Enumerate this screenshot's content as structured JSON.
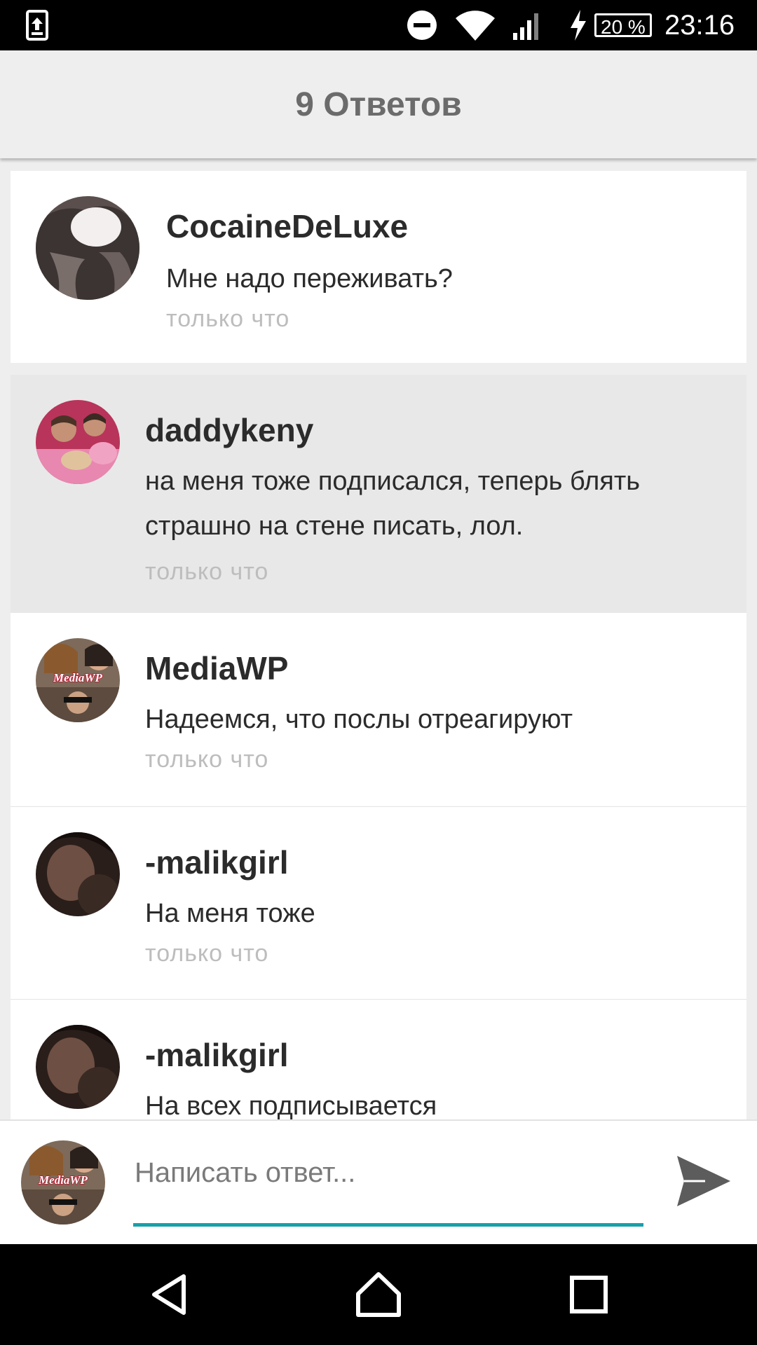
{
  "status_bar": {
    "time": "23:16",
    "battery": "20 %",
    "icons": [
      "upload-notification-icon",
      "do-not-disturb-icon",
      "wifi-icon",
      "signal-icon",
      "charging-icon"
    ]
  },
  "header": {
    "title": "9 Ответов"
  },
  "replies": [
    {
      "username": "CocaineDeLuxe",
      "message": "Мне надо переживать?",
      "time": "только что",
      "highlighted": false
    },
    {
      "username": "daddykeny",
      "message": "на меня тоже подписался, теперь блять страшно на стене писать, лол.",
      "time": "только что",
      "highlighted": true
    },
    {
      "username": "MediaWP",
      "message": "Надеемся, что послы отреагируют",
      "time": "только что",
      "highlighted": false,
      "avatar_text": "MediaWP"
    },
    {
      "username": "-malikgirl",
      "message": "На меня тоже",
      "time": "только что",
      "highlighted": false
    },
    {
      "username": "-malikgirl",
      "message": "На всех подписывается",
      "time": "",
      "highlighted": false
    }
  ],
  "reply_bar": {
    "placeholder": "Написать ответ...",
    "avatar_text": "MediaWP",
    "accent_color": "#17a0ab"
  },
  "nav_bar": {
    "icons": [
      "back-icon",
      "home-icon",
      "recents-icon"
    ]
  }
}
